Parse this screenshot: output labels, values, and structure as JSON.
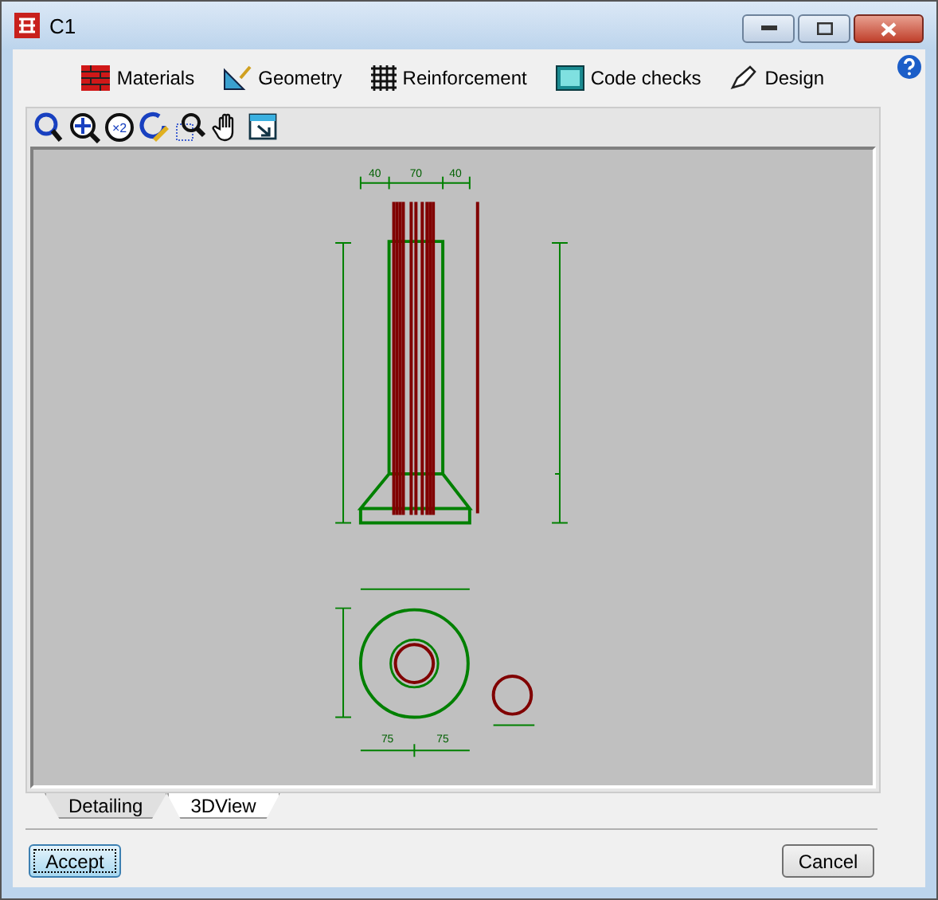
{
  "window": {
    "title": "C1"
  },
  "menu": [
    {
      "label": "Materials",
      "kind": "bricks"
    },
    {
      "label": "Geometry",
      "kind": "square"
    },
    {
      "label": "Reinforcement",
      "kind": "grid"
    },
    {
      "label": "Code checks",
      "kind": "calc"
    },
    {
      "label": "Design",
      "kind": "pen"
    }
  ],
  "tools": [
    {
      "kind": "zoom-prev"
    },
    {
      "kind": "zoom-all"
    },
    {
      "kind": "zoom-2"
    },
    {
      "kind": "redraw"
    },
    {
      "kind": "zoom-window"
    },
    {
      "kind": "pan"
    },
    {
      "kind": "export"
    }
  ],
  "zoom_2_label": "×2",
  "drawing": {
    "dims": [
      "40",
      "70",
      "40",
      "75",
      "75"
    ]
  },
  "tabs": [
    {
      "label": "Detailing",
      "selected": false
    },
    {
      "label": "3DView",
      "selected": true
    }
  ],
  "buttons": [
    {
      "label": "Accept",
      "kind": "default"
    },
    {
      "label": "Cancel",
      "kind": "normal"
    }
  ]
}
